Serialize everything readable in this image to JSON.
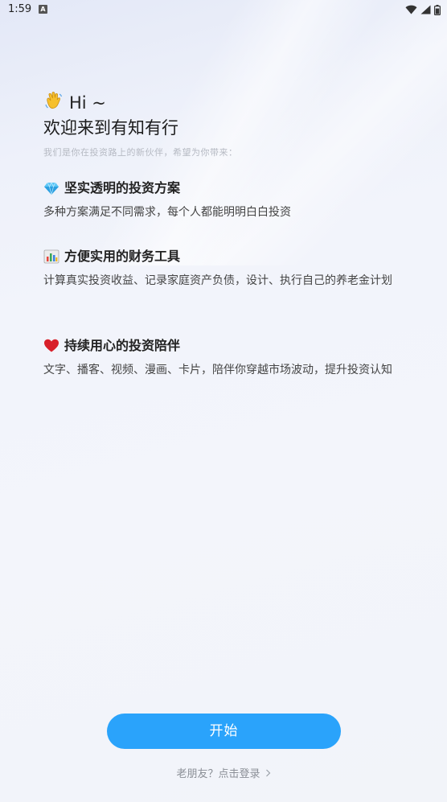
{
  "status_bar": {
    "time": "1:59",
    "notification_badge": "A",
    "icons": [
      "wifi-icon",
      "signal-icon",
      "battery-icon"
    ]
  },
  "hero": {
    "greeting_emoji": "waving-hand-icon",
    "greeting": "Hi ~",
    "title": "欢迎来到有知有行",
    "subtitle": "我们是你在投资路上的新伙伴，希望为你带来："
  },
  "features": [
    {
      "icon": "gem-icon",
      "title": "坚实透明的投资方案",
      "description": "多种方案满足不同需求，每个人都能明明白白投资"
    },
    {
      "icon": "bar-chart-icon",
      "title": "方便实用的财务工具",
      "description": "计算真实投资收益、记录家庭资产负债，设计、执行自己的养老金计划"
    },
    {
      "icon": "heart-icon",
      "title": "持续用心的投资陪伴",
      "description": "文字、播客、视频、漫画、卡片，陪伴你穿越市场波动，提升投资认知"
    }
  ],
  "actions": {
    "start_label": "开始",
    "login_label": "老朋友？点击登录"
  },
  "colors": {
    "accent": "#2aa3fb",
    "subtitle": "#b6bac3",
    "heart": "#d8202a"
  }
}
